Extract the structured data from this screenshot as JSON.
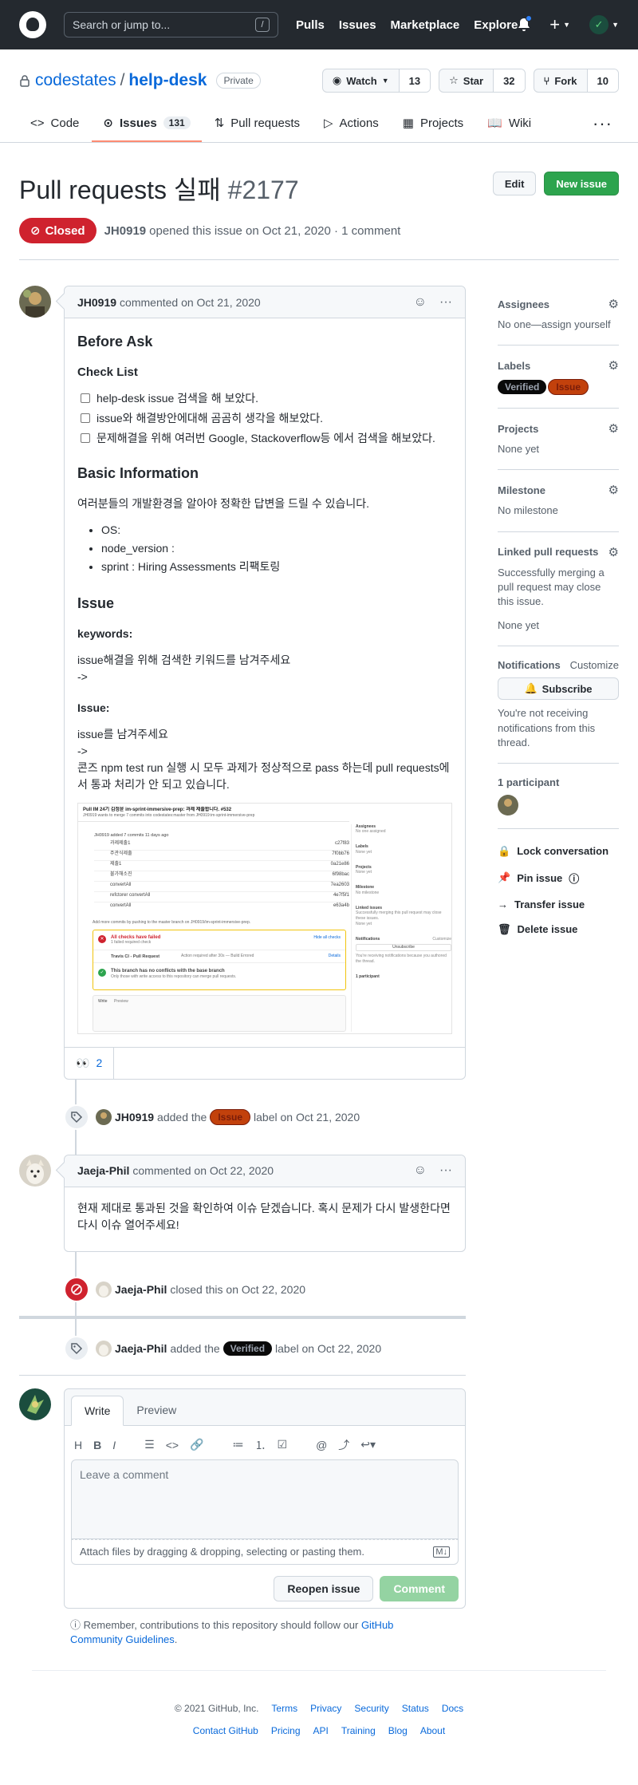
{
  "header": {
    "search_placeholder": "Search or jump to...",
    "slash": "/",
    "nav": [
      "Pulls",
      "Issues",
      "Marketplace",
      "Explore"
    ]
  },
  "repo": {
    "owner": "codestates",
    "name": "help-desk",
    "visibility": "Private",
    "watch": {
      "label": "Watch",
      "count": "13"
    },
    "star": {
      "label": "Star",
      "count": "32"
    },
    "fork": {
      "label": "Fork",
      "count": "10"
    }
  },
  "tabs": [
    {
      "label": "Code"
    },
    {
      "label": "Issues",
      "count": "131"
    },
    {
      "label": "Pull requests"
    },
    {
      "label": "Actions"
    },
    {
      "label": "Projects"
    },
    {
      "label": "Wiki"
    }
  ],
  "issue": {
    "title": "Pull requests 실패",
    "number": "#2177",
    "edit": "Edit",
    "new_issue": "New issue",
    "state": "Closed",
    "author": "JH0919",
    "meta": "opened this issue on Oct 21, 2020 · 1 comment"
  },
  "comment1": {
    "author": "JH0919",
    "meta": "commented on Oct 21, 2020",
    "h_before": "Before Ask",
    "h_check": "Check List",
    "checks": [
      "help-desk issue 검색을 해 보았다.",
      "issue와 해결방안에대해 곰곰히 생각을 해보았다.",
      "문제해결을 위해 여러번 Google, Stackoverflow등 에서 검색을 해보았다."
    ],
    "h_basic": "Basic Information",
    "basic_p": "여러분들의 개발환경을 알아야 정확한 답변을 드릴 수 있습니다.",
    "bullets": [
      "OS:",
      "node_version :",
      "sprint : Hiring Assessments 리팩토링"
    ],
    "h_issue": "Issue",
    "kw_label": "keywords:",
    "kw_text1": "issue해결을 위해 검색한 키워드를 남겨주세요",
    "kw_text2": "->",
    "issue_label": "Issue:",
    "issue_text1": "issue를 남겨주세요",
    "issue_text2": "->",
    "issue_text3": "콘즈 npm test run 실행 시 모두 과제가 정상적으로 pass 하는데 pull requests에서 통과 처리가 안 되고 있습니다.",
    "reaction_count": "2",
    "reaction_emoji": "👀"
  },
  "screenshot": {
    "title": "Pull IM 24기 김정윤 im-sprint-immersive-prep: 과제 제출합니다. #532",
    "sub": "JH0919 wants to merge 7 commits into codestates:master from JH0919:im-sprint-immersive-prep",
    "added": "JH0919 added 7 commits 11 days ago",
    "commits": [
      [
        "과제제출1",
        "c27f83"
      ],
      [
        "주관식제출",
        "7f0bb76"
      ],
      [
        "제출1",
        "0a21e86"
      ],
      [
        "불가해소진",
        "6f98bac"
      ],
      [
        "convertAll",
        "7ea2603"
      ],
      [
        "refctorer convertAll",
        "4e7f5f1"
      ],
      [
        "convertAll",
        "e63a4b"
      ]
    ],
    "more": "Add more commits by pushing to the master branch on JH0919/im-sprint-immersive-prep.",
    "fail": "All checks have failed",
    "fail_sub": "1 failed required check",
    "hide": "Hide all checks",
    "travis": "Travis CI - Pull Request",
    "travis_sub": "Action required after 30s — Build Errored",
    "details": "Details",
    "noconf": "This branch has no conflicts with the base branch",
    "noconf_sub": "Only those with write access to this repository can merge pull requests.",
    "write": "Write",
    "preview": "Preview",
    "side": [
      "Assignees",
      "No one assigned",
      "Labels",
      "None yet",
      "Projects",
      "None yet",
      "Milestone",
      "No milestone",
      "Linked issues",
      "Successfully merging this pull request may close these issues.",
      "None yet",
      "Notifications",
      "Customize",
      "Unsubscribe",
      "You're receiving notifications because you authored the thread.",
      "1 participant"
    ]
  },
  "events": {
    "label1": {
      "author": "JH0919",
      "pre": "added the",
      "label": "Issue",
      "post": "label on Oct 21, 2020"
    },
    "closed": {
      "author": "Jaeja-Phil",
      "text": "closed this on Oct 22, 2020"
    },
    "label2": {
      "author": "Jaeja-Phil",
      "pre": "added the",
      "label": "Verified",
      "post": "label on Oct 22, 2020"
    }
  },
  "comment2": {
    "author": "Jaeja-Phil",
    "meta": "commented on Oct 22, 2020",
    "body": "현재 제대로 통과된 것을 확인하여 이슈 닫겠습니다. 혹시 문제가 다시 발생한다면 다시 이슈 열어주세요!"
  },
  "newcomment": {
    "tab_write": "Write",
    "tab_preview": "Preview",
    "placeholder": "Leave a comment",
    "attach": "Attach files by dragging & dropping, selecting or pasting them.",
    "reopen": "Reopen issue",
    "comment": "Comment",
    "remind": "Remember, contributions to this repository should follow our",
    "remind_link": "GitHub Community Guidelines",
    "remind_end": "."
  },
  "sidebar": {
    "assignees": {
      "title": "Assignees",
      "value": "No one—assign yourself"
    },
    "labels": {
      "title": "Labels",
      "items": [
        "Verified",
        "Issue"
      ]
    },
    "projects": {
      "title": "Projects",
      "value": "None yet"
    },
    "milestone": {
      "title": "Milestone",
      "value": "No milestone"
    },
    "linked": {
      "title": "Linked pull requests",
      "desc": "Successfully merging a pull request may close this issue.",
      "value": "None yet"
    },
    "notifications": {
      "title": "Notifications",
      "customize": "Customize",
      "subscribe": "Subscribe",
      "note": "You're not receiving notifications from this thread."
    },
    "participants": {
      "title": "1 participant"
    },
    "actions": [
      "Lock conversation",
      "Pin issue",
      "Transfer issue",
      "Delete issue"
    ]
  },
  "footer": {
    "copyright": "© 2021 GitHub, Inc.",
    "row1": [
      "Terms",
      "Privacy",
      "Security",
      "Status",
      "Docs"
    ],
    "row2": [
      "Contact GitHub",
      "Pricing",
      "API",
      "Training",
      "Blog",
      "About"
    ]
  },
  "colors": {
    "accent": "#0969da",
    "closed": "#cf222e",
    "green": "#2da44e",
    "label_issue": "#c2410c",
    "label_verified": "#0a0a0a"
  }
}
